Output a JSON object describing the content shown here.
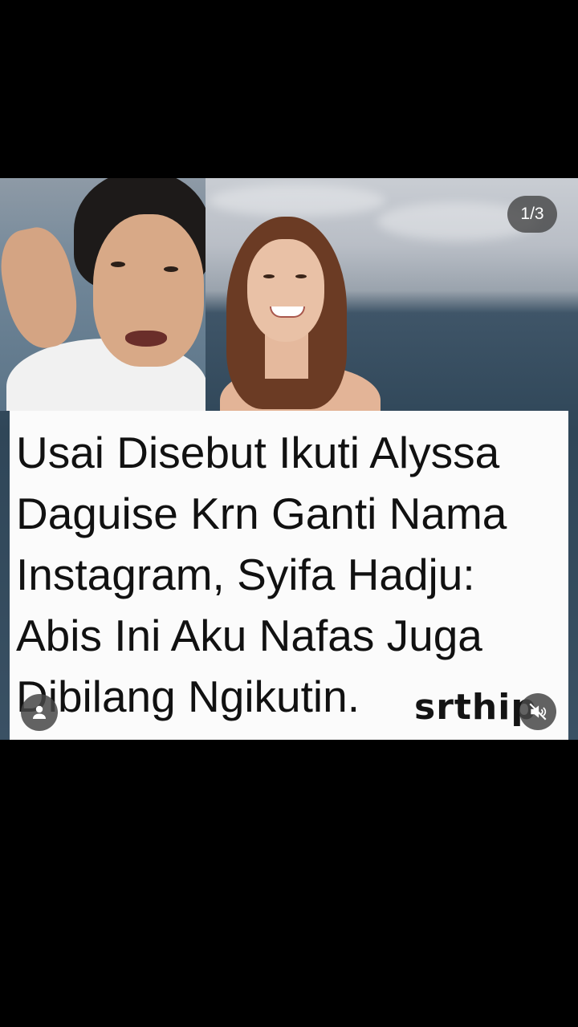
{
  "post": {
    "page_counter": "1/3",
    "caption": "Usai Disebut Ikuti Alyssa Daguise Krn Ganti Nama Instagram, Syifa Hadju: Abis Ini Aku Nafas Juga Dibilang Ngikutin.",
    "watermark": "srthip"
  },
  "icons": {
    "profile": "person-icon",
    "mute": "speaker-muted-icon"
  },
  "colors": {
    "background": "#000000",
    "caption_bg": "#fbfbfb",
    "caption_text": "#111111",
    "overlay_button": "#464646"
  }
}
